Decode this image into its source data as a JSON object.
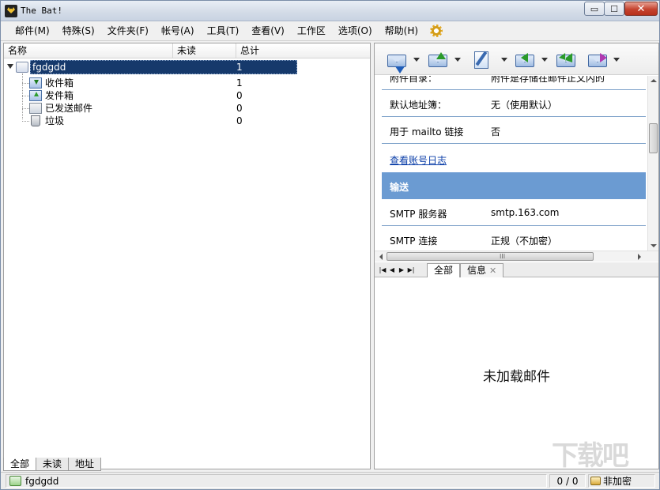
{
  "window": {
    "title": "The Bat!",
    "min_glyph": "▭",
    "max_glyph": "☐",
    "close_glyph": "✕"
  },
  "menu": [
    "邮件(M)",
    "特殊(S)",
    "文件夹(F)",
    "帐号(A)",
    "工具(T)",
    "查看(V)",
    "工作区",
    "选项(O)",
    "帮助(H)"
  ],
  "folder_list": {
    "columns": {
      "name": "名称",
      "unread": "未读",
      "total": "总计"
    },
    "account": {
      "name": "fgdgdd",
      "total": "1"
    },
    "folders": [
      {
        "name": "收件箱",
        "unread": "",
        "total": "1",
        "icon": "inbox-icon"
      },
      {
        "name": "发件箱",
        "unread": "",
        "total": "0",
        "icon": "outbox-icon"
      },
      {
        "name": "已发送邮件",
        "unread": "",
        "total": "0",
        "icon": "sent-icon"
      },
      {
        "name": "垃圾",
        "unread": "",
        "total": "0",
        "icon": "trash-icon"
      }
    ],
    "tabs": [
      "全部",
      "未读",
      "地址"
    ]
  },
  "toolbar": [
    "get-mail-icon",
    "send-mail-icon",
    "new-message-icon",
    "reply-icon",
    "reply-all-icon",
    "forward-icon"
  ],
  "account_props": {
    "partial_row": {
      "key": "附件目录：",
      "value": "附件是存储在邮件正文内的"
    },
    "rows": [
      {
        "key": "默认地址簿：",
        "value": "无（使用默认）"
      },
      {
        "key": "用于 mailto 链接",
        "value": "否"
      }
    ],
    "link": "查看账号日志",
    "section": "输送",
    "section_rows": [
      {
        "key": "SMTP 服务器",
        "value": "smtp.163.com"
      },
      {
        "key": "SMTP 连接",
        "value": "正规（不加密）"
      }
    ]
  },
  "message_tabs": {
    "all": "全部",
    "info": "信息",
    "close_glyph": "✕"
  },
  "nav_glyphs": [
    "|◀",
    "◀",
    "▶",
    "▶|"
  ],
  "scroll_grip": "III",
  "preview": {
    "empty_text": "未加载邮件"
  },
  "status": {
    "account": "fgdgdd",
    "count": "0 / 0",
    "encryption": "非加密"
  },
  "watermark": "下载吧"
}
